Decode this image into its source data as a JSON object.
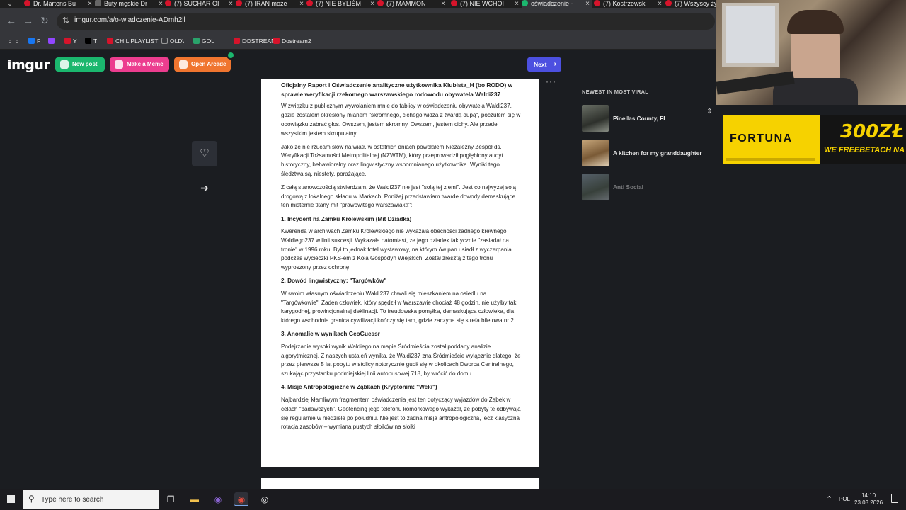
{
  "browser": {
    "tabs": [
      {
        "title": "Dr. Martens Bu",
        "icon": "youtube-icon"
      },
      {
        "title": "Buty męskie Dr",
        "icon": "site-icon"
      },
      {
        "title": "(7) SUCHAR OI",
        "icon": "youtube-icon"
      },
      {
        "title": "(7) IRAN może",
        "icon": "youtube-icon"
      },
      {
        "title": "(7) NIE BYLIŚM",
        "icon": "youtube-icon"
      },
      {
        "title": "(7) MAMMON",
        "icon": "youtube-icon"
      },
      {
        "title": "(7) NIE WCHOI",
        "icon": "youtube-icon"
      },
      {
        "title": "oświadczenie -",
        "icon": "imgur-icon",
        "active": true
      },
      {
        "title": "(7) Kostrzewsk",
        "icon": "youtube-icon"
      },
      {
        "title": "(7) Wszyscy żyj",
        "icon": "youtube-icon"
      }
    ],
    "url": "imgur.com/a/o-wiadczenie-ADmh2ll",
    "bookmarks": [
      {
        "label": "F",
        "icon": "facebook-icon",
        "color": "#1877f2"
      },
      {
        "label": "",
        "icon": "twitch-icon",
        "color": "#9146ff"
      },
      {
        "label": "Y",
        "icon": "youtube-icon",
        "color": "#d6142b"
      },
      {
        "label": "T",
        "icon": "x-icon",
        "color": "#000000"
      },
      {
        "label": "CHIL PLAYLIST",
        "icon": "youtube-icon",
        "color": "#d6142b"
      },
      {
        "label": "OLD\\",
        "icon": "folder-icon",
        "color": "#999999"
      },
      {
        "label": "GOL",
        "icon": "site-icon",
        "color": "#2aa36b"
      },
      {
        "label": "DOSTREAM1",
        "icon": "youtube-icon",
        "color": "#d6142b"
      },
      {
        "label": "Dostream2",
        "icon": "youtube-icon",
        "color": "#d6142b"
      }
    ]
  },
  "imgur": {
    "logo": "imgur",
    "new_post": "New post",
    "make_meme": "Make a Meme",
    "open_arcade": "Open Arcade",
    "next": "Next",
    "post": {
      "title": "Oficjalny Raport i Oświadczenie analityczne użytkownika Klubista_H (bo RODO) w sprawie weryfikacji rzekomego warszawskiego rodowodu obywatela Waldi237",
      "paragraphs": [
        "W związku z publicznym wywołaniem mnie do tablicy w oświadczeniu obywatela Waldi237, gdzie zostałem określony mianem \"skromnego, cichego widza z twardą dupą\", poczułem się w obowiązku zabrać głos. Owszem, jestem skromny. Owszem, jestem cichy. Ale przede wszystkim jestem skrupulatny.",
        "Jako że nie rzucam słów na wiatr, w ostatnich dniach powołałem Niezależny Zespół ds. Weryfikacji Tożsamości Metropolitalnej (NZWTM), który przeprowadził pogłębiony audyt historyczny, behawioralny oraz lingwistyczny wspomnianego użytkownika. Wyniki tego śledztwa są, niestety, porażające.",
        "Z całą stanowczością stwierdzam, że Waldi237 nie jest \"solą tej ziemi\". Jest co najwyżej solą drogową z lokalnego składu w Markach. Poniżej przedstawiam twarde dowody demaskujące ten misternie tkany mit \"prawowitego warszawiaka\":"
      ],
      "sections": [
        {
          "heading": "1. Incydent na Zamku Królewskim (Mit Dziadka)",
          "text": "Kwerenda w archiwach Zamku Królewskiego nie wykazała obecności żadnego krewnego Waldiego237 w linii sukcesji. Wykazała natomiast, że jego dziadek faktycznie \"zasiadał na tronie\" w 1996 roku. Był to jednak fotel wystawowy, na którym ów pan usiadł z wyczerpania podczas wycieczki PKS-em z Koła Gospodyń Wiejskich. Został zresztą z tego tronu wyproszony przez ochronę."
        },
        {
          "heading": "2. Dowód lingwistyczny: \"Targówków\"",
          "text": "W swoim własnym oświadczeniu Waldi237 chwali się mieszkaniem na osiedlu na \"Targówkowie\". Żaden człowiek, który spędził w Warszawie chociaż 48 godzin, nie użyłby tak karygodnej, prowincjonalnej deklinacji. To freudowska pomyłka, demaskująca człowieka, dla którego wschodnia granica cywilizacji kończy się tam, gdzie zaczyna się strefa biletowa nr 2."
        },
        {
          "heading": "3. Anomalie w wynikach GeoGuessr",
          "text": "Podejrzanie wysoki wynik Waldiego na mapie Śródmieścia został poddany analizie algorytmicznej. Z naszych ustaleń wynika, że Waldi237 zna Śródmieście wyłącznie dlatego, że przez pierwsze 5 lat pobytu w stolicy notorycznie gubił się w okolicach Dworca Centralnego, szukając przystanku podmiejskiej linii autobusowej 718, by wrócić do domu."
        },
        {
          "heading": "4. Misje Antropologiczne w Ząbkach (Kryptonim: \"Weki\")",
          "text": "Najbardziej kłamliwym fragmentem oświadczenia jest ten dotyczący wyjazdów do Ząbek w celach \"badawczych\". Geofencing jego telefonu komórkowego wykazał, że pobyty te odbywają się regularnie w niedziele po południu. Nie jest to żadna misja antropologiczna, lecz klasyczna rotacja zasobów – wymiana pustych słoików na słoiki"
        }
      ]
    },
    "viral": {
      "heading": "NEWEST IN MOST VIRAL",
      "items": [
        {
          "title": "Pinellas County, FL"
        },
        {
          "title": "A kitchen for my granddaughter"
        },
        {
          "title": "Anti Social"
        }
      ]
    }
  },
  "overlay": {
    "ad_brand": "FORTUNA",
    "ad_amount": "300ZŁ",
    "ad_promo": "WE FREEBETACH NA STAR"
  },
  "taskbar": {
    "search_placeholder": "Type here to search",
    "language": "POL",
    "time": "14:10",
    "date": "23.03.2026"
  }
}
